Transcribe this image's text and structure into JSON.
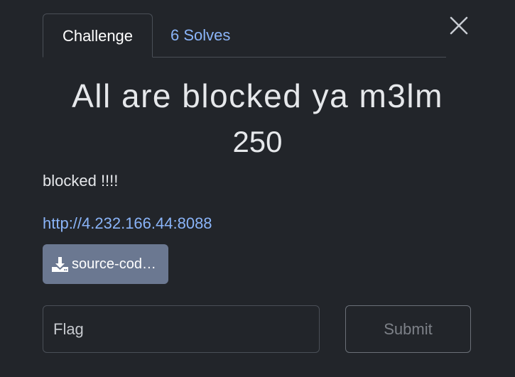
{
  "tabs": {
    "challenge_label": "Challenge",
    "solves_label": "6 Solves"
  },
  "challenge": {
    "name": "All are blocked ya m3lm",
    "value": "250",
    "description": "blocked !!!!",
    "url": "http://4.232.166.44:8088",
    "file_label": "source-cod…"
  },
  "form": {
    "flag_placeholder": "Flag",
    "flag_value": "",
    "submit_label": "Submit"
  },
  "icons": {
    "close": "close-icon",
    "download": "download-icon"
  },
  "colors": {
    "background": "#22252a",
    "link": "#8ab4f8",
    "file_button": "#6b7891"
  }
}
